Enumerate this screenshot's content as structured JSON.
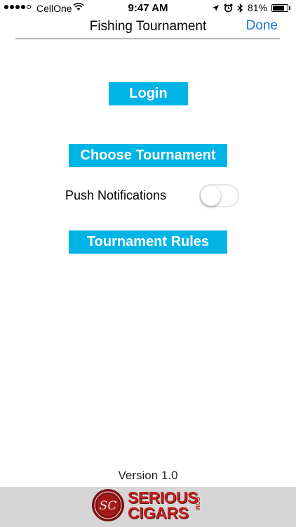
{
  "status_bar": {
    "carrier": "CellOne",
    "time": "9:47 AM",
    "battery": "81%",
    "battery_level": 0.81,
    "signal_bars_filled": 4,
    "signal_bars_total": 5,
    "icons": [
      "wifi-icon",
      "location-arrow-icon",
      "alarm-icon",
      "bluetooth-icon",
      "battery-icon"
    ]
  },
  "nav": {
    "title": "Fishing Tournament",
    "done_label": "Done",
    "accent_color": "#1a73e8"
  },
  "main": {
    "login_label": "Login",
    "choose_label": "Choose Tournament",
    "push_label": "Push Notifications",
    "push_enabled": false,
    "rules_label": "Tournament Rules",
    "button_color": "#00b4e6"
  },
  "footer": {
    "version": "Version 1.0",
    "logo_line1": "SERIOUS",
    "logo_line2": "CIGARS",
    "logo_suffix": ".COM",
    "seal_initials": "SC",
    "logo_color": "#c0201e"
  }
}
